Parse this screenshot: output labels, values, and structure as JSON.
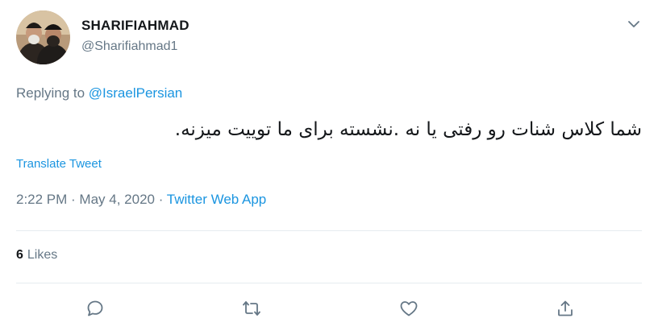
{
  "author": {
    "display_name": "SHARIFIAHMAD",
    "handle": "@Sharifiahmad1",
    "avatar_icon": "profile-photo-two-clerics"
  },
  "reply": {
    "prefix": "Replying to ",
    "mention": "@IsraelPersian"
  },
  "tweet": {
    "text": "شما کلاس شنات رو رفتی یا نه .نشسته برای ما توییت میزنه.",
    "translate_label": "Translate Tweet"
  },
  "meta": {
    "time": "2:22 PM",
    "sep1": " · ",
    "date": "May 4, 2020",
    "sep2": " · ",
    "source": "Twitter Web App"
  },
  "stats": {
    "likes_count": "6",
    "likes_label": "Likes"
  },
  "actions": [
    {
      "icon": "reply-icon"
    },
    {
      "icon": "retweet-icon"
    },
    {
      "icon": "like-icon"
    },
    {
      "icon": "share-icon"
    }
  ],
  "colors": {
    "link": "#1b95e0",
    "muted": "#657786",
    "text": "#14171a",
    "divider": "#e6ecf0"
  }
}
